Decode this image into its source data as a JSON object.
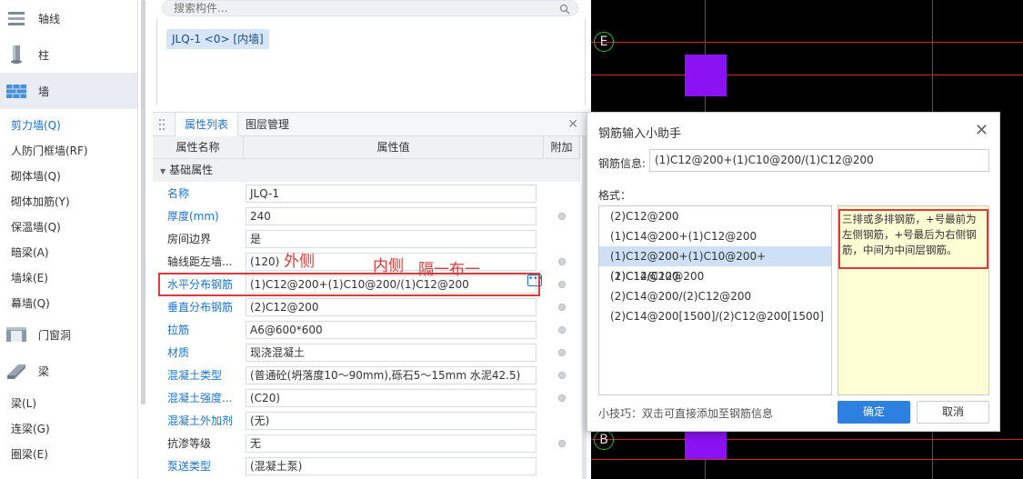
{
  "nav": {
    "categories": [
      {
        "label": "轴线",
        "icon": "axis-icon"
      },
      {
        "label": "柱",
        "icon": "column-icon"
      },
      {
        "label": "墙",
        "icon": "wall-icon"
      }
    ],
    "wall_items": [
      "剪力墙(Q)",
      "人防门框墙(RF)",
      "砌体墙(Q)",
      "砌体加筋(Y)",
      "保温墙(Q)",
      "暗梁(A)",
      "墙垛(E)",
      "幕墙(Q)"
    ],
    "door_label": "门窗洞",
    "beam_label": "梁",
    "beam_items": [
      "梁(L)",
      "连梁(G)",
      "圈梁(E)"
    ]
  },
  "search": {
    "placeholder": "搜索构件..."
  },
  "component": {
    "tag": "JLQ-1 <0> [内墙]"
  },
  "tabs": {
    "attr": "属性列表",
    "layer": "图层管理"
  },
  "grid": {
    "headers": {
      "name": "属性名称",
      "value": "属性值",
      "extra": "附加"
    },
    "group": "基础属性",
    "rows": [
      {
        "name": "名称",
        "value": "JLQ-1",
        "blue": true,
        "dot": false
      },
      {
        "name": "厚度(mm)",
        "value": "240",
        "blue": true,
        "dot": true
      },
      {
        "name": "房间边界",
        "value": "是",
        "blue": false,
        "dot": false
      },
      {
        "name": "轴线距左墙...",
        "value": "(120)",
        "blue": false,
        "dot": true
      },
      {
        "name": "水平分布钢筋",
        "value": "(1)C12@200+(1)C10@200/(1)C12@200",
        "blue": true,
        "dot": true
      },
      {
        "name": "垂直分布钢筋",
        "value": "(2)C12@200",
        "blue": true,
        "dot": true
      },
      {
        "name": "拉筋",
        "value": "A6@600*600",
        "blue": true,
        "dot": true
      },
      {
        "name": "材质",
        "value": "现浇混凝土",
        "blue": true,
        "dot": true
      },
      {
        "name": "混凝土类型",
        "value": "(普通砼(坍落度10～90mm),砾石5～15mm 水泥42.5)",
        "blue": true,
        "dot": true
      },
      {
        "name": "混凝土强度...",
        "value": "(C20)",
        "blue": true,
        "dot": true
      },
      {
        "name": "混凝土外加剂",
        "value": "(无)",
        "blue": true,
        "dot": false
      },
      {
        "name": "抗渗等级",
        "value": "无",
        "blue": false,
        "dot": true
      },
      {
        "name": "泵送类型",
        "value": "(混凝土泵)",
        "blue": true,
        "dot": false
      }
    ]
  },
  "annotations": {
    "outer": "外侧",
    "inner": "内侧",
    "alternate": "隔一布一"
  },
  "cad": {
    "axis_top": "E",
    "axis_bottom": "B"
  },
  "dialog": {
    "title": "钢筋输入小助手",
    "info_label": "钢筋信息:",
    "info_value": "(1)C12@200+(1)C10@200/(1)C12@200",
    "format_label": "格式：",
    "formats": [
      "(2)C12@200",
      "(1)C14@200+(1)C12@200",
      "(1)C12@200+(1)C10@200+(1)C12@200",
      "(2)C14/C12@200",
      "(2)C14@200/(2)C12@200",
      "(2)C14@200[1500]/(2)C12@200[1500]"
    ],
    "selected_format_index": 2,
    "tip": "三排或多排钢筋，+号最前为左侧钢筋，+号最后为右侧钢筋，中间为中间层钢筋。",
    "hint": "小技巧：双击可直接添加至钢筋信息",
    "ok": "确定",
    "cancel": "取消"
  }
}
